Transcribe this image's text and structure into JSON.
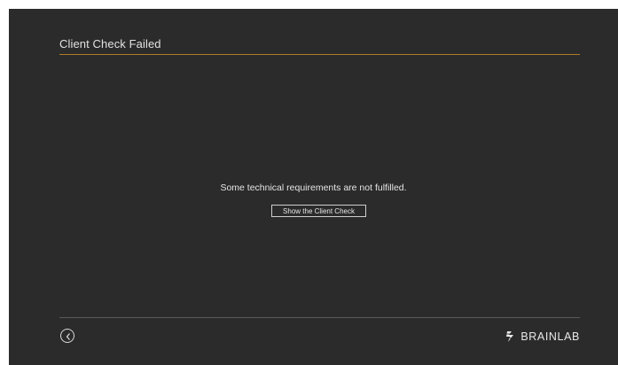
{
  "window": {
    "title": "Client Check Failed"
  },
  "main": {
    "message": "Some technical requirements are not fulfilled.",
    "show_check_label": "Show the Client Check"
  },
  "footer": {
    "back_icon": "chevron-left-circle-icon",
    "brand": "BRAINLAB",
    "brand_icon": "brainlab-logo-mark"
  },
  "colors": {
    "background": "#2b2b2b",
    "title_divider": "#b07a2a",
    "text": "#e6e6e6"
  }
}
